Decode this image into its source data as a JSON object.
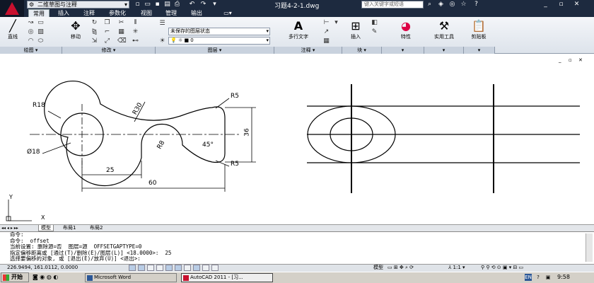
{
  "titlebar": {
    "workspace": "二维草图与注释",
    "document_title": "习题4-2-1.dwg",
    "search_placeholder": "键入关键字或短语"
  },
  "tabs": [
    {
      "label": "常用",
      "active": true
    },
    {
      "label": "插入",
      "active": false
    },
    {
      "label": "注释",
      "active": false
    },
    {
      "label": "参数化",
      "active": false
    },
    {
      "label": "视图",
      "active": false
    },
    {
      "label": "管理",
      "active": false
    },
    {
      "label": "输出",
      "active": false
    }
  ],
  "ribbon": {
    "draw_panel": {
      "title": "绘图",
      "line_label": "直线"
    },
    "modify_panel": {
      "title": "修改",
      "move_label": "移动"
    },
    "layer_panel": {
      "title": "图层",
      "layer_state": "未保存的图层状态",
      "current_layer": "0"
    },
    "annotation_panel": {
      "title": "注释",
      "mtext_label": "多行文字"
    },
    "block_panel": {
      "title": "块",
      "insert_label": "插入"
    },
    "properties_label": "特性",
    "utilities_label": "实用工具",
    "clipboard_label": "剪贴板"
  },
  "drawing": {
    "dims": {
      "r18": "R18",
      "r30": "R30",
      "r5_top": "R5",
      "r5_bottom": "R5",
      "r8": "R8",
      "phi18": "Ø18",
      "d36": "36",
      "d25": "25",
      "d60": "60",
      "angle": "45°"
    },
    "ucs": {
      "x": "X",
      "y": "Y"
    }
  },
  "layout_tabs": [
    {
      "label": "模型",
      "active": true
    },
    {
      "label": "布局1",
      "active": false
    },
    {
      "label": "布局2",
      "active": false
    }
  ],
  "command_lines": [
    "命令:",
    "命令:  offset",
    "当前设置: 删除源=否  图层=源  OFFSETGAPTYPE=0",
    "指定偏移距离或 [通过(T)/删除(E)/图层(L)] <18.0000>:  25",
    "选择要偏移的对象, 或 [退出(E)/放弃(U)] <退出>:"
  ],
  "status": {
    "coords": "226.9494, 161.0112, 0.0000",
    "model_label": "模型",
    "scale": "1:1"
  },
  "taskbar": {
    "start_label": "开始",
    "tasks": [
      "Microsoft Word",
      "AutoCAD 2011 - [习..."
    ],
    "lang": "EN",
    "time": "9:58"
  },
  "colors": {
    "title_bg": "#1d2a3f",
    "accent": "#c8102e",
    "drawing_bg": "#ffffff"
  }
}
